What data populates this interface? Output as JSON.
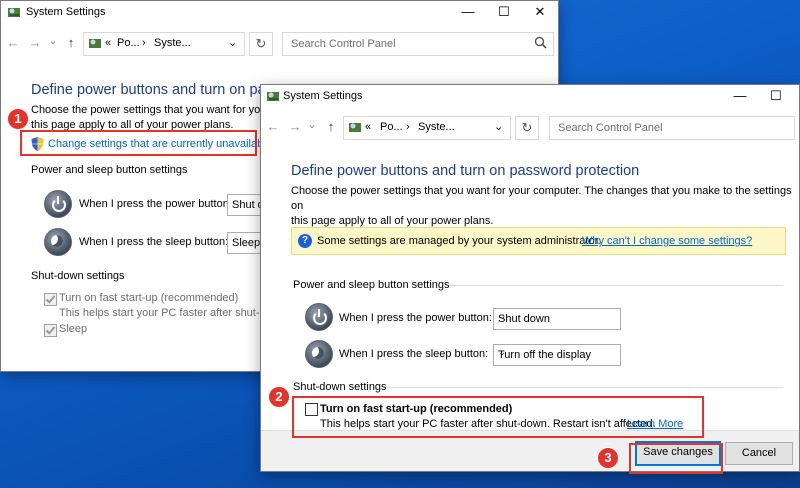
{
  "window_title": "System Settings",
  "window_controls": {
    "minimize": "—",
    "maximize": "☐",
    "close": "✕"
  },
  "nav": {
    "back": "←",
    "forward": "→",
    "dropdown": "⌄",
    "up": "↑",
    "refresh": "↻"
  },
  "back_window": {
    "breadcrumb": [
      "«",
      "Po...",
      "›",
      "Syste..."
    ],
    "search_placeholder": "Search Control Panel",
    "heading": "Define power buttons and turn on passw",
    "description_line1": "Choose the power settings that you want for your c",
    "description_line2": "this page apply to all of your power plans.",
    "change_settings_link": "Change settings that are currently unavailable",
    "power_sleep_section": "Power and sleep button settings",
    "power_button_label": "When I press the power button:",
    "power_button_value": "Shut do",
    "sleep_button_label": "When I press the sleep button:",
    "sleep_button_value": "Sleep",
    "shutdown_section": "Shut-down settings",
    "fast_startup_label": "Turn on fast start-up (recommended)",
    "fast_startup_desc": "This helps start your PC faster after shut-down.",
    "sleep_label": "Sleep"
  },
  "front_window": {
    "breadcrumb": [
      "«",
      "Po...",
      "›",
      "Syste..."
    ],
    "search_placeholder": "Search Control Panel",
    "heading": "Define power buttons and turn on password protection",
    "description_line1": "Choose the power settings that you want for your computer. The changes that you make to the settings on",
    "description_line2": "this page apply to all of your power plans.",
    "info_text": "Some settings are managed by your system administrator.",
    "info_link": "Why can't I change some settings?",
    "power_sleep_section": "Power and sleep button settings",
    "power_button_label": "When I press the power button:",
    "power_button_value": "Shut down",
    "sleep_button_label": "When I press the sleep button:",
    "sleep_button_value": "Turn off the display",
    "shutdown_section": "Shut-down settings",
    "fast_startup_label": "Turn on fast start-up (recommended)",
    "fast_startup_desc": "This helps start your PC faster after shut-down. Restart isn't affected.",
    "learn_more": "Learn More",
    "save_button": "Save changes",
    "cancel_button": "Cancel"
  },
  "badges": [
    "1",
    "2",
    "3"
  ],
  "colors": {
    "accent": "#0078d7",
    "annotation_red": "#e3342b",
    "heading_blue": "#1e3c8c",
    "link": "#0066cc"
  }
}
